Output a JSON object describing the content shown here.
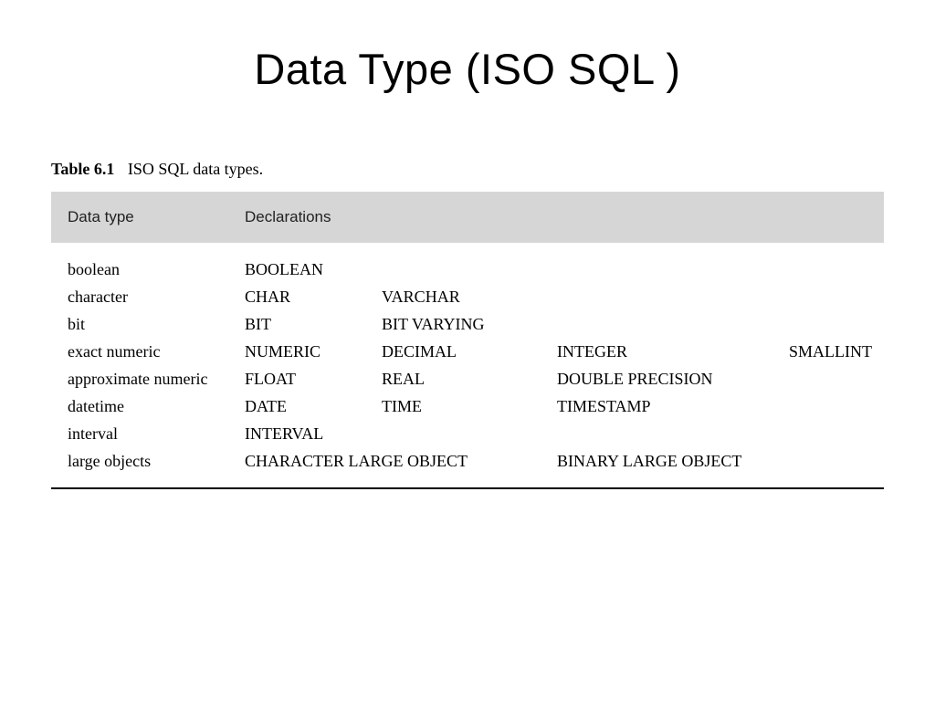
{
  "title": "Data Type (ISO SQL )",
  "caption": {
    "label": "Table 6.1",
    "text": "ISO SQL data types."
  },
  "headers": {
    "col0": "Data type",
    "col1": "Declarations"
  },
  "rows": [
    {
      "c0": "boolean",
      "c1": "BOOLEAN",
      "c2": "",
      "c3": "",
      "c4": ""
    },
    {
      "c0": "character",
      "c1": "CHAR",
      "c2": "VARCHAR",
      "c3": "",
      "c4": ""
    },
    {
      "c0": "bit",
      "c1": "BIT",
      "c2": "BIT VARYING",
      "c3": "",
      "c4": ""
    },
    {
      "c0": "exact numeric",
      "c1": "NUMERIC",
      "c2": "DECIMAL",
      "c3": "INTEGER",
      "c4": "SMALLINT"
    },
    {
      "c0": "approximate numeric",
      "c1": "FLOAT",
      "c2": "REAL",
      "c3": "DOUBLE PRECISION",
      "c4": ""
    },
    {
      "c0": "datetime",
      "c1": "DATE",
      "c2": "TIME",
      "c3": "TIMESTAMP",
      "c4": ""
    },
    {
      "c0": "interval",
      "c1": "INTERVAL",
      "c2": "",
      "c3": "",
      "c4": ""
    },
    {
      "c0": "large objects",
      "c1": "CHARACTER LARGE OBJECT",
      "c1wide": true,
      "c3": "BINARY LARGE OBJECT",
      "c2": "",
      "c4": ""
    }
  ]
}
